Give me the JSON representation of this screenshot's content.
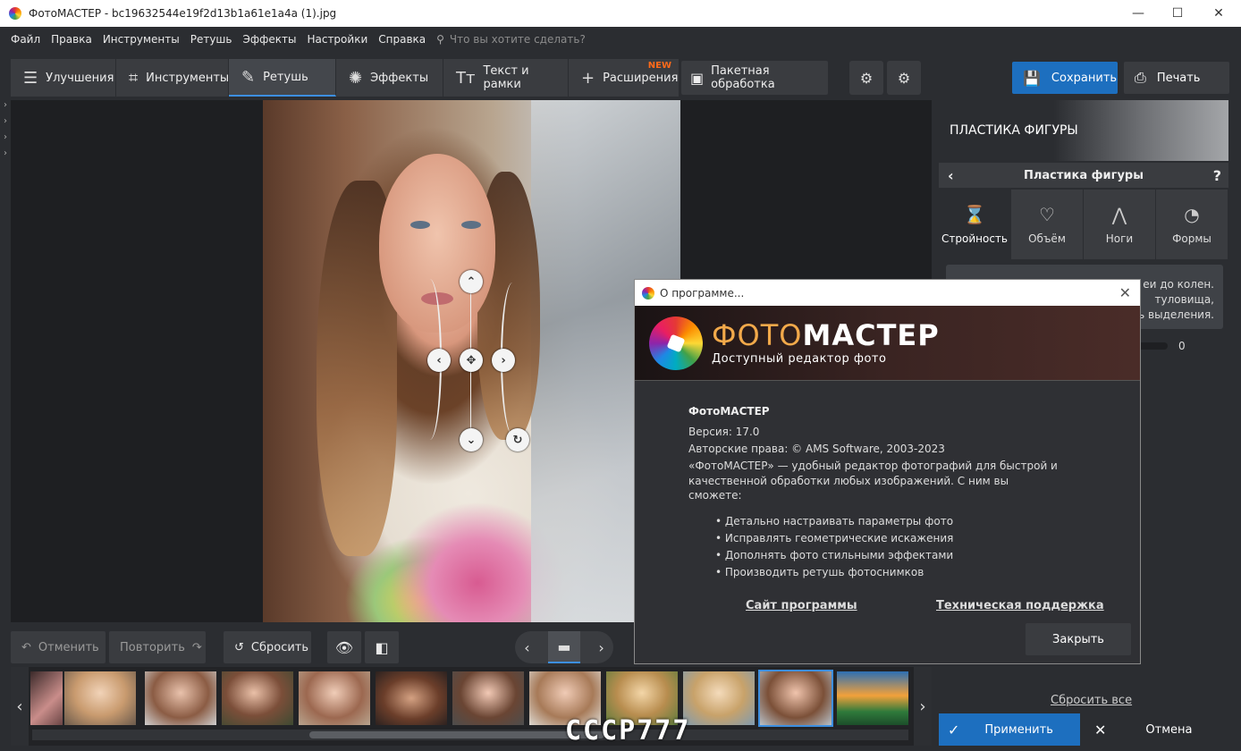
{
  "window": {
    "title": "ФотоМАСТЕР - bc19632544e19f2d13b1a61e1a4a (1).jpg"
  },
  "menu": {
    "items": [
      "Файл",
      "Правка",
      "Инструменты",
      "Ретушь",
      "Эффекты",
      "Настройки",
      "Справка"
    ],
    "search_placeholder": "Что вы хотите сделать?"
  },
  "tabs": [
    {
      "label": "Улучшения",
      "icon": "sliders-icon"
    },
    {
      "label": "Инструменты",
      "icon": "crop-icon"
    },
    {
      "label": "Ретушь",
      "icon": "brush-icon"
    },
    {
      "label": "Эффекты",
      "icon": "sparkle-icon"
    },
    {
      "label": "Текст и рамки",
      "icon": "text-icon"
    },
    {
      "label": "Расширения",
      "icon": "plus-icon",
      "badge": "NEW"
    }
  ],
  "toolbar": {
    "batch_label": "Пакетная обработка",
    "save_label": "Сохранить",
    "print_label": "Печать"
  },
  "bottom": {
    "undo_label": "Отменить",
    "redo_label": "Повторить",
    "reset_label": "Сбросить"
  },
  "watermark": "СССР777",
  "right_panel": {
    "header": "ПЛАСТИКА ФИГУРЫ",
    "subheader": "Пластика фигуры",
    "tabs": [
      {
        "label": "Стройность"
      },
      {
        "label": "Объём"
      },
      {
        "label": "Ноги"
      },
      {
        "label": "Формы"
      }
    ],
    "note_lines": [
      "еи до колен.",
      "туловища,",
      "ть выделения."
    ],
    "slider_value": "0",
    "reset_all": "Сбросить все",
    "apply_label": "Применить",
    "cancel_label": "Отмена"
  },
  "dialog": {
    "title": "О программе...",
    "brand_part1": "ФОТО",
    "brand_part2": "МАСТЕР",
    "tagline": "Доступный редактор фото",
    "app_name": "ФотоМАСТЕР",
    "version": "Версия: 17.0",
    "copyright": "Авторские права: © AMS Software, 2003-2023",
    "desc_line1": "«ФотоМАСТЕР» — удобный редактор фотографий для быстрой и",
    "desc_line2": "качественной обработки любых изображений. С ним вы сможете:",
    "features": [
      "• Детально настраивать параметры фото",
      "• Исправлять геометрические искажения",
      "• Дополнять фото стильными эффектами",
      "• Производить ретушь фотоснимков"
    ],
    "site_link": "Сайт программы",
    "support_link": "Техническая поддержка",
    "close_label": "Закрыть"
  },
  "colors": {
    "accent": "#1d6fbf",
    "new_badge": "#ff6a1a",
    "bg": "#2b2d31"
  }
}
